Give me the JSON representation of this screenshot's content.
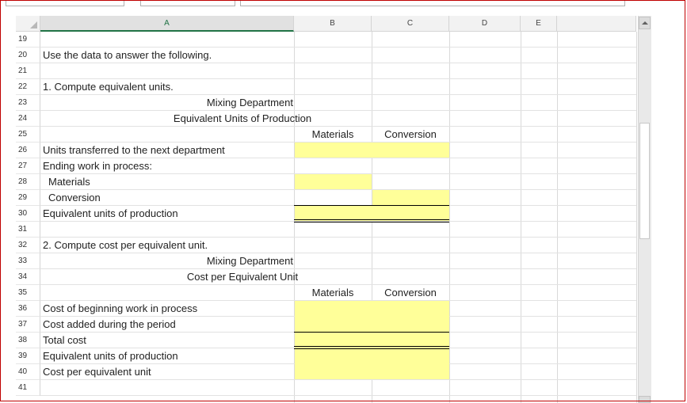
{
  "sheet": {
    "columns": [
      {
        "key": "col-a",
        "label": "A",
        "active": true
      },
      {
        "key": "col-b",
        "label": "B"
      },
      {
        "key": "col-c",
        "label": "C"
      },
      {
        "key": "col-d",
        "label": "D"
      },
      {
        "key": "col-e",
        "label": "E"
      }
    ],
    "rows": [
      "19",
      "20",
      "21",
      "22",
      "23",
      "24",
      "25",
      "26",
      "27",
      "28",
      "29",
      "30",
      "31",
      "32",
      "33",
      "34",
      "35",
      "36",
      "37",
      "38",
      "39",
      "40",
      "41"
    ],
    "cells": {
      "r20": "Use the data to answer the following.",
      "r22": "1. Compute equivalent units.",
      "r23": "Mixing Department",
      "r24": "Equivalent Units of Production",
      "r25_b": "Materials",
      "r25_c": "Conversion",
      "r26": "Units transferred to the next department",
      "r27": "Ending work in process:",
      "r28": "Materials",
      "r29": "Conversion",
      "r30": "Equivalent units of production",
      "r32": "2. Compute cost per equivalent unit.",
      "r33": "Mixing Department",
      "r34": "Cost per Equivalent Unit",
      "r35_b": "Materials",
      "r35_c": "Conversion",
      "r36": "Cost of beginning work in process",
      "r37": "Cost added during the period",
      "r38": "Total cost",
      "r39": "Equivalent units of production",
      "r40": "Cost per equivalent unit"
    }
  },
  "colors": {
    "input_fill": "#ffff99",
    "active_header": "#217346",
    "frame": "#c00000"
  }
}
